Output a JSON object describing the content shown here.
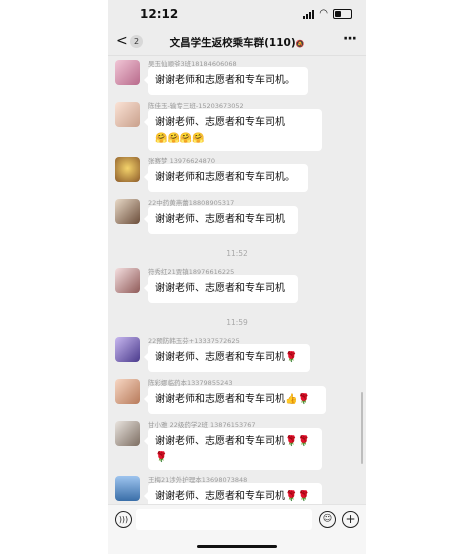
{
  "status": {
    "time": "12:12"
  },
  "nav": {
    "back_count": "2",
    "title": "文昌学生返校乘车群(110)",
    "mute_icon": "🔕"
  },
  "messages": [
    {
      "sender": "吴玉仙顺爷3班18184606068",
      "text": "谢谢老师和志愿者和专车司机。",
      "emojis": ""
    },
    {
      "sender": "陈佳玉-输专三班-15203673052",
      "text": "谢谢老师、志愿者和专车司机",
      "emojis": "🤗🤗🤗🤗"
    },
    {
      "sender": "张赛梦 13976624870",
      "text": "谢谢老师和志愿者和专车司机。",
      "emojis": ""
    },
    {
      "sender": "22中药黄燕蕾18808905317",
      "text": "谢谢老师、志愿者和专车司机",
      "emojis": ""
    },
    {
      "sender": "符秀红21贾镇18976616225",
      "text": "谢谢老师、志愿者和专车司机",
      "emojis": ""
    },
    {
      "sender": "22预防韩玉芬+13337572625",
      "text": "谢谢老师、志愿者和专车司机",
      "emojis": "🌹"
    },
    {
      "sender": "陈彩娜临药本13379855243",
      "text": "谢谢老师和志愿者和专车司机",
      "emojis": "👍🌹"
    },
    {
      "sender": "甘小雅 22级药学2班 13876153767",
      "text": "谢谢老师、志愿者和专车司机",
      "emojis": "🌹🌹",
      "emojis2": "🌹"
    },
    {
      "sender": "王梅21涉外护理本13698073848",
      "text": "谢谢老师、志愿者和专车司机",
      "emojis": "🌹🌹"
    }
  ],
  "timestamps": [
    "11:52",
    "11:59"
  ],
  "colors": {
    "chat_bg": "#ededed",
    "bubble": "#ffffff",
    "meta_text": "#9a9a9a"
  }
}
